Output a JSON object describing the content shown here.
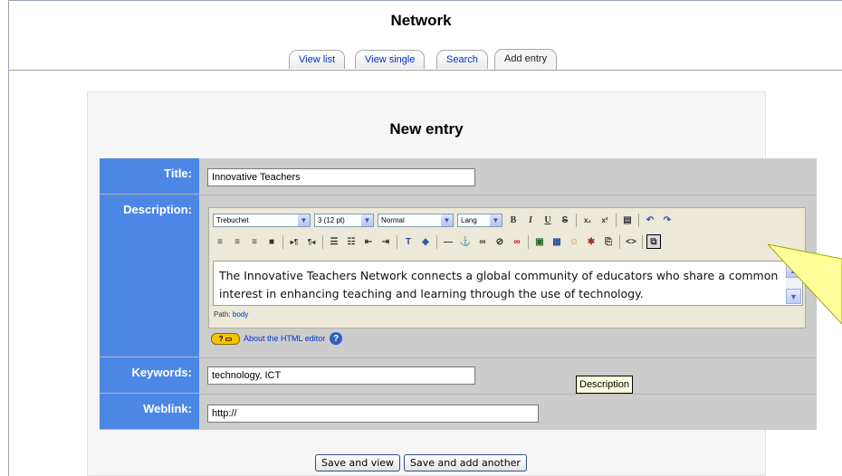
{
  "page": {
    "title": "Network"
  },
  "tabs": [
    {
      "label": "View list"
    },
    {
      "label": "View single"
    },
    {
      "label": "Search"
    },
    {
      "label": "Add entry",
      "active": true
    }
  ],
  "form": {
    "heading": "New entry",
    "fields": {
      "title": {
        "label": "Title:",
        "value": "Innovative Teachers"
      },
      "description": {
        "label": "Description:"
      },
      "keywords": {
        "label": "Keywords:",
        "value": "technology, ICT"
      },
      "weblink": {
        "label": "Weblink:",
        "value": "http://"
      }
    }
  },
  "editor": {
    "font": "Trebuchet",
    "size": "3 (12 pt)",
    "format": "Normal",
    "lang": "Lang",
    "content": "The Innovative Teachers Network connects a global community of educators who share a common interest in enhancing teaching and learning through the use of technology.",
    "path_label": "Path:",
    "path_value": "body",
    "help_link": "About the HTML editor",
    "help_badge": "?"
  },
  "tooltip": "Description",
  "buttons": {
    "save_view": "Save and view",
    "save_add": "Save and add another"
  },
  "colors": {
    "label_bg": "#4d87e6",
    "form_bg": "#cccccc",
    "callout": "#ffff99",
    "link": "#0033cc"
  }
}
